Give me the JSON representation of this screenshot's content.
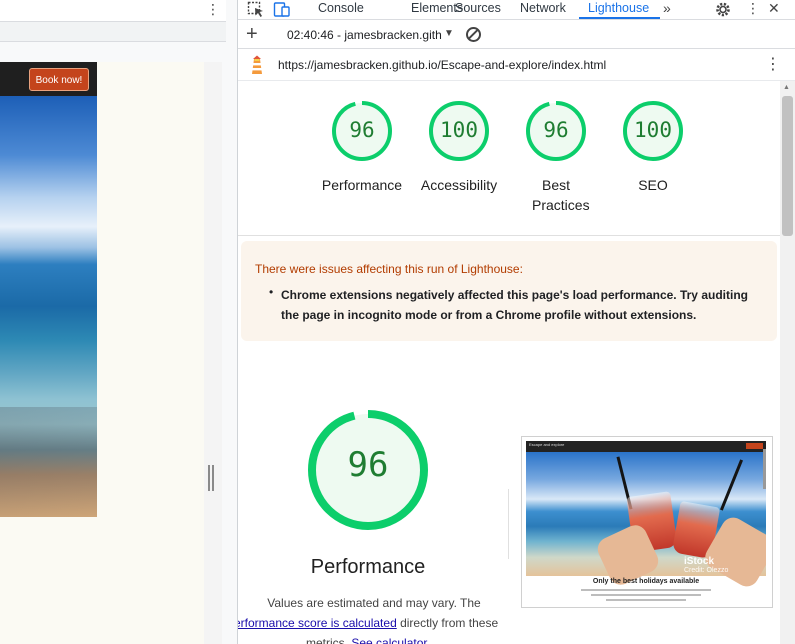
{
  "left_page": {
    "book_now_label": "Book now!",
    "menu_icon": "kebab-menu-icon"
  },
  "devtools": {
    "tabs": [
      "Console",
      "Elements",
      "Sources",
      "Network",
      "Lighthouse"
    ],
    "active_tab": "Lighthouse",
    "accent_color": "#1a73e8",
    "toolbar": {
      "run_label": "02:40:46 - jamesbracken.gith",
      "icons": [
        "add-icon",
        "caret-down-icon",
        "clear-icon"
      ]
    },
    "report_url": "https://jamesbracken.github.io/Escape-and-explore/index.html"
  },
  "scores": [
    {
      "label": "Performance",
      "value": "96",
      "percent": 96
    },
    {
      "label": "Accessibility",
      "value": "100",
      "percent": 100
    },
    {
      "label": "Best Practices",
      "value": "96",
      "percent": 96
    },
    {
      "label": "SEO",
      "value": "100",
      "percent": 100
    }
  ],
  "score_color": "#0cce6b",
  "warning": {
    "title": "There were issues affecting this run of Lighthouse:",
    "items": [
      "Chrome extensions negatively affected this page's load performance. Try auditing the page in incognito mode or from a Chrome profile without extensions."
    ]
  },
  "performance": {
    "value": "96",
    "percent": 96,
    "title": "Performance",
    "desc_line1": "Values are estimated and may vary. The",
    "desc_link1": "erformance score is calculated",
    "desc_after_link1": " directly from these",
    "desc_line3_prefix": "metrics. ",
    "desc_link2": "See calculator."
  },
  "thumbnail": {
    "brand": "Escape and explore",
    "watermark": "iStock",
    "watermark_credit": "Credit: Olezzo",
    "headline": "Only the best holidays available"
  }
}
